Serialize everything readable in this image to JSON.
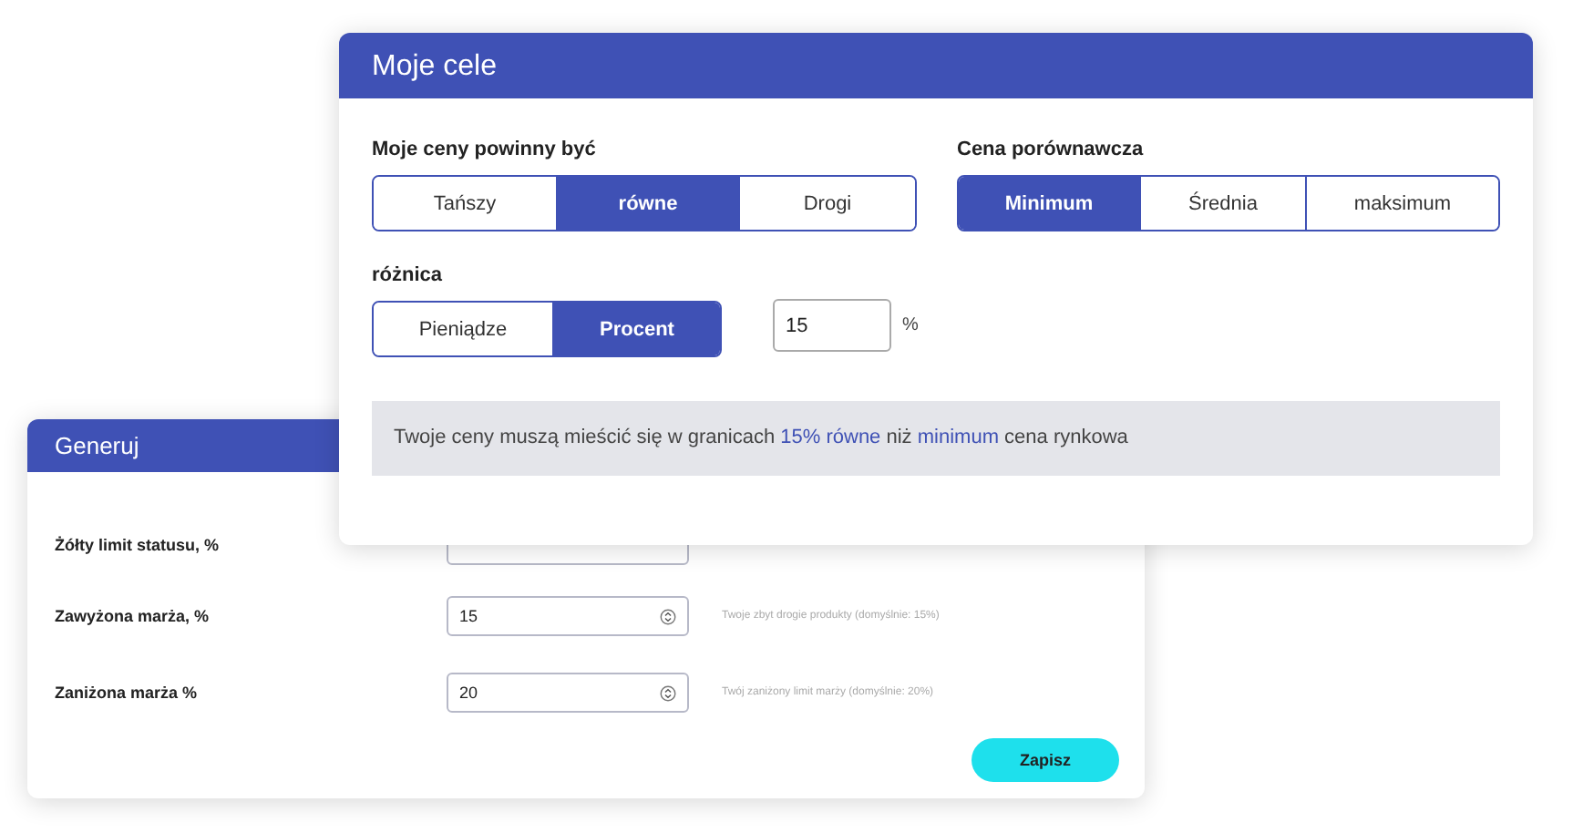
{
  "back_card": {
    "title": "Generuj",
    "fields": [
      {
        "label": "Żółty limit statusu, %"
      },
      {
        "label": "Zawyżona marża, %",
        "value": "15",
        "hint": "Twoje zbyt drogie produkty (domyślnie: 15%)"
      },
      {
        "label": "Zaniżona marża %",
        "value": "20",
        "hint": "Twój zaniżony limit marży (domyślnie: 20%)"
      }
    ],
    "save_button": "Zapisz"
  },
  "front_card": {
    "title": "Moje cele",
    "price_position": {
      "label": "Moje ceny powinny być",
      "options": [
        {
          "label": "Tańszy",
          "selected": false
        },
        {
          "label": "równe",
          "selected": true
        },
        {
          "label": "Drogi",
          "selected": false
        }
      ]
    },
    "comparison_price": {
      "label": "Cena porównawcza",
      "options": [
        {
          "label": "Minimum",
          "selected": true
        },
        {
          "label": "Średnia",
          "selected": false
        },
        {
          "label": "maksimum",
          "selected": false
        }
      ]
    },
    "difference": {
      "label": "różnica",
      "options": [
        {
          "label": "Pieniądze",
          "selected": false
        },
        {
          "label": "Procent",
          "selected": true
        }
      ],
      "value": "15",
      "unit": "%"
    },
    "summary": [
      {
        "text": "Twoje ceny muszą mieścić się w granicach ",
        "highlight": false
      },
      {
        "text": "15% równe",
        "highlight": true
      },
      {
        "text": " niż ",
        "highlight": false
      },
      {
        "text": "minimum",
        "highlight": true
      },
      {
        "text": " cena rynkowa",
        "highlight": false
      }
    ]
  }
}
